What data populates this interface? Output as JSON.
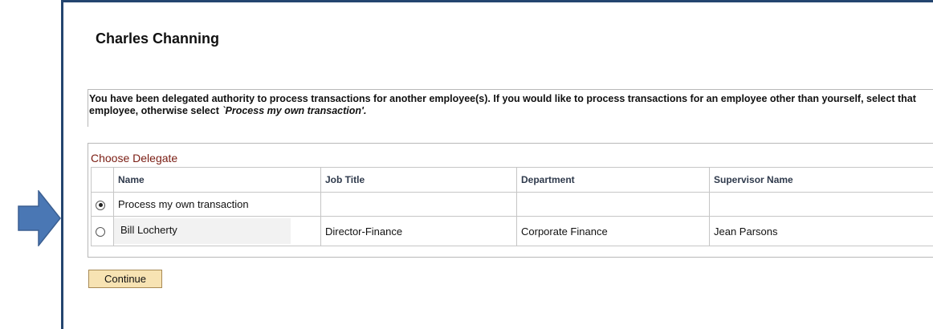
{
  "page": {
    "title": "Charles Channing",
    "instructions_part1": "You have been delegated authority to process transactions for another employee(s). If you would like to process transactions for an employee other than yourself, select that employee, otherwise select ",
    "instructions_emphasis": "`Process my own transaction'.",
    "grid_caption": "Choose Delegate",
    "continue_label": "Continue"
  },
  "table": {
    "headers": [
      "Name",
      "Job Title",
      "Department",
      "Supervisor Name"
    ],
    "rows": [
      {
        "selected": true,
        "name": "Process my own transaction",
        "job_title": "",
        "department": "",
        "supervisor": ""
      },
      {
        "selected": false,
        "name": "Bill Locherty",
        "job_title": "Director-Finance",
        "department": "Corporate Finance",
        "supervisor": "Jean Parsons"
      }
    ]
  },
  "colors": {
    "arrow": "#4a77b4",
    "frame": "#24456f",
    "caption": "#7a1c12",
    "button_bg": "#f7e3b3"
  },
  "icons": {
    "pointer": "right-arrow-icon",
    "radio_selected": "radio-selected-icon",
    "radio_unselected": "radio-unselected-icon"
  }
}
